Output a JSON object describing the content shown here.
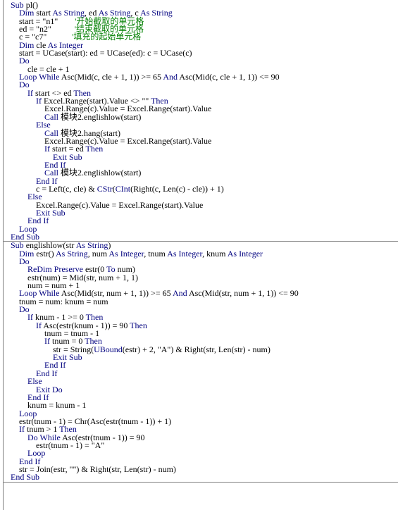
{
  "editor": {
    "title": "VBA Code Module",
    "colors": {
      "background": "#ffffff",
      "keyword": "#00007f",
      "comment": "#007f00",
      "text": "#000000",
      "rule": "#808080"
    }
  },
  "procedures": [
    {
      "name": "pl",
      "lines": [
        [
          {
            "t": "Sub ",
            "c": "kw"
          },
          {
            "t": "pl()",
            "c": "plain"
          }
        ],
        [
          {
            "t": "    ",
            "c": "plain"
          },
          {
            "t": "Dim ",
            "c": "kw"
          },
          {
            "t": "start ",
            "c": "plain"
          },
          {
            "t": "As String",
            "c": "kw"
          },
          {
            "t": ", ed ",
            "c": "plain"
          },
          {
            "t": "As String",
            "c": "kw"
          },
          {
            "t": ", c ",
            "c": "plain"
          },
          {
            "t": "As String",
            "c": "kw"
          }
        ],
        [
          {
            "t": "    start = \"n1\"        ",
            "c": "plain"
          },
          {
            "t": "'开始截取的单元格",
            "c": "cmt"
          }
        ],
        [
          {
            "t": "    ed = \"n2\"           ",
            "c": "plain"
          },
          {
            "t": "'结束截取的单元格",
            "c": "cmt"
          }
        ],
        [
          {
            "t": "    c = \"c7\"            ",
            "c": "plain"
          },
          {
            "t": "'填充的起始单元格",
            "c": "cmt"
          }
        ],
        [
          {
            "t": "    ",
            "c": "plain"
          },
          {
            "t": "Dim ",
            "c": "kw"
          },
          {
            "t": "cle ",
            "c": "plain"
          },
          {
            "t": "As Integer",
            "c": "kw"
          }
        ],
        [
          {
            "t": "    start = UCase(start): ed = UCase(ed): c = UCase(c)",
            "c": "plain"
          }
        ],
        [
          {
            "t": "    ",
            "c": "plain"
          },
          {
            "t": "Do",
            "c": "kw"
          }
        ],
        [
          {
            "t": "        cle = cle + 1",
            "c": "plain"
          }
        ],
        [
          {
            "t": "    ",
            "c": "plain"
          },
          {
            "t": "Loop While ",
            "c": "kw"
          },
          {
            "t": "Asc(Mid(c, cle + 1, 1)) >= 65 ",
            "c": "plain"
          },
          {
            "t": "And ",
            "c": "kw"
          },
          {
            "t": "Asc(Mid(c, cle + 1, 1)) <= 90",
            "c": "plain"
          }
        ],
        [
          {
            "t": "    ",
            "c": "plain"
          },
          {
            "t": "Do",
            "c": "kw"
          }
        ],
        [
          {
            "t": "        ",
            "c": "plain"
          },
          {
            "t": "If ",
            "c": "kw"
          },
          {
            "t": "start <> ed ",
            "c": "plain"
          },
          {
            "t": "Then",
            "c": "kw"
          }
        ],
        [
          {
            "t": "            ",
            "c": "plain"
          },
          {
            "t": "If ",
            "c": "kw"
          },
          {
            "t": "Excel.Range(start).Value <> \"\" ",
            "c": "plain"
          },
          {
            "t": "Then",
            "c": "kw"
          }
        ],
        [
          {
            "t": "                Excel.Range(c).Value = Excel.Range(start).Value",
            "c": "plain"
          }
        ],
        [
          {
            "t": "                ",
            "c": "plain"
          },
          {
            "t": "Call ",
            "c": "kw"
          },
          {
            "t": "模块2.englishlow(start)",
            "c": "plain"
          }
        ],
        [
          {
            "t": "            ",
            "c": "plain"
          },
          {
            "t": "Else",
            "c": "kw"
          }
        ],
        [
          {
            "t": "                ",
            "c": "plain"
          },
          {
            "t": "Call ",
            "c": "kw"
          },
          {
            "t": "模块2.hang(start)",
            "c": "plain"
          }
        ],
        [
          {
            "t": "                Excel.Range(c).Value = Excel.Range(start).Value",
            "c": "plain"
          }
        ],
        [
          {
            "t": "                ",
            "c": "plain"
          },
          {
            "t": "If ",
            "c": "kw"
          },
          {
            "t": "start = ed ",
            "c": "plain"
          },
          {
            "t": "Then",
            "c": "kw"
          }
        ],
        [
          {
            "t": "                    ",
            "c": "plain"
          },
          {
            "t": "Exit Sub",
            "c": "kw"
          }
        ],
        [
          {
            "t": "                ",
            "c": "plain"
          },
          {
            "t": "End If",
            "c": "kw"
          }
        ],
        [
          {
            "t": "                ",
            "c": "plain"
          },
          {
            "t": "Call ",
            "c": "kw"
          },
          {
            "t": "模块2.englishlow(start)",
            "c": "plain"
          }
        ],
        [
          {
            "t": "            ",
            "c": "plain"
          },
          {
            "t": "End If",
            "c": "kw"
          }
        ],
        [
          {
            "t": "            c = Left(c, cle) & ",
            "c": "plain"
          },
          {
            "t": "CStr",
            "c": "kw"
          },
          {
            "t": "(",
            "c": "plain"
          },
          {
            "t": "CInt",
            "c": "kw"
          },
          {
            "t": "(Right(c, Len(c) - cle)) + 1)",
            "c": "plain"
          }
        ],
        [
          {
            "t": "        ",
            "c": "plain"
          },
          {
            "t": "Else",
            "c": "kw"
          }
        ],
        [
          {
            "t": "            Excel.Range(c).Value = Excel.Range(start).Value",
            "c": "plain"
          }
        ],
        [
          {
            "t": "            ",
            "c": "plain"
          },
          {
            "t": "Exit Sub",
            "c": "kw"
          }
        ],
        [
          {
            "t": "        ",
            "c": "plain"
          },
          {
            "t": "End If",
            "c": "kw"
          }
        ],
        [
          {
            "t": "    ",
            "c": "plain"
          },
          {
            "t": "Loop",
            "c": "kw"
          }
        ],
        [
          {
            "t": "End Sub",
            "c": "kw"
          }
        ]
      ]
    },
    {
      "name": "englishlow",
      "lines": [
        [
          {
            "t": "Sub ",
            "c": "kw"
          },
          {
            "t": "englishlow(str ",
            "c": "plain"
          },
          {
            "t": "As String",
            "c": "kw"
          },
          {
            "t": ")",
            "c": "plain"
          }
        ],
        [
          {
            "t": "    ",
            "c": "plain"
          },
          {
            "t": "Dim ",
            "c": "kw"
          },
          {
            "t": "estr() ",
            "c": "plain"
          },
          {
            "t": "As String",
            "c": "kw"
          },
          {
            "t": ", num ",
            "c": "plain"
          },
          {
            "t": "As Integer",
            "c": "kw"
          },
          {
            "t": ", tnum ",
            "c": "plain"
          },
          {
            "t": "As Integer",
            "c": "kw"
          },
          {
            "t": ", knum ",
            "c": "plain"
          },
          {
            "t": "As Integer",
            "c": "kw"
          }
        ],
        [
          {
            "t": "    ",
            "c": "plain"
          },
          {
            "t": "Do",
            "c": "kw"
          }
        ],
        [
          {
            "t": "        ",
            "c": "plain"
          },
          {
            "t": "ReDim Preserve ",
            "c": "kw"
          },
          {
            "t": "estr(0 ",
            "c": "plain"
          },
          {
            "t": "To",
            "c": "kw"
          },
          {
            "t": " num)",
            "c": "plain"
          }
        ],
        [
          {
            "t": "        estr(num) = Mid(str, num + 1, 1)",
            "c": "plain"
          }
        ],
        [
          {
            "t": "        num = num + 1",
            "c": "plain"
          }
        ],
        [
          {
            "t": "    ",
            "c": "plain"
          },
          {
            "t": "Loop While ",
            "c": "kw"
          },
          {
            "t": "Asc(Mid(str, num + 1, 1)) >= 65 ",
            "c": "plain"
          },
          {
            "t": "And ",
            "c": "kw"
          },
          {
            "t": "Asc(Mid(str, num + 1, 1)) <= 90",
            "c": "plain"
          }
        ],
        [
          {
            "t": "    tnum = num: knum = num",
            "c": "plain"
          }
        ],
        [
          {
            "t": "    ",
            "c": "plain"
          },
          {
            "t": "Do",
            "c": "kw"
          }
        ],
        [
          {
            "t": "        ",
            "c": "plain"
          },
          {
            "t": "If ",
            "c": "kw"
          },
          {
            "t": "knum - 1 >= 0 ",
            "c": "plain"
          },
          {
            "t": "Then",
            "c": "kw"
          }
        ],
        [
          {
            "t": "            ",
            "c": "plain"
          },
          {
            "t": "If ",
            "c": "kw"
          },
          {
            "t": "Asc(estr(knum - 1)) = 90 ",
            "c": "plain"
          },
          {
            "t": "Then",
            "c": "kw"
          }
        ],
        [
          {
            "t": "                tnum = tnum - 1",
            "c": "plain"
          }
        ],
        [
          {
            "t": "                ",
            "c": "plain"
          },
          {
            "t": "If ",
            "c": "kw"
          },
          {
            "t": "tnum = 0 ",
            "c": "plain"
          },
          {
            "t": "Then",
            "c": "kw"
          }
        ],
        [
          {
            "t": "                    str = String(",
            "c": "plain"
          },
          {
            "t": "UBound",
            "c": "kw"
          },
          {
            "t": "(estr) + 2, \"A\") & Right(str, Len(str) - num)",
            "c": "plain"
          }
        ],
        [
          {
            "t": "                    ",
            "c": "plain"
          },
          {
            "t": "Exit Sub",
            "c": "kw"
          }
        ],
        [
          {
            "t": "                ",
            "c": "plain"
          },
          {
            "t": "End If",
            "c": "kw"
          }
        ],
        [
          {
            "t": "            ",
            "c": "plain"
          },
          {
            "t": "End If",
            "c": "kw"
          }
        ],
        [
          {
            "t": "        ",
            "c": "plain"
          },
          {
            "t": "Else",
            "c": "kw"
          }
        ],
        [
          {
            "t": "            ",
            "c": "plain"
          },
          {
            "t": "Exit Do",
            "c": "kw"
          }
        ],
        [
          {
            "t": "        ",
            "c": "plain"
          },
          {
            "t": "End If",
            "c": "kw"
          }
        ],
        [
          {
            "t": "        knum = knum - 1",
            "c": "plain"
          }
        ],
        [
          {
            "t": "    ",
            "c": "plain"
          },
          {
            "t": "Loop",
            "c": "kw"
          }
        ],
        [
          {
            "t": "    estr(tnum - 1) = Chr(Asc(estr(tnum - 1)) + 1)",
            "c": "plain"
          }
        ],
        [
          {
            "t": "    ",
            "c": "plain"
          },
          {
            "t": "If ",
            "c": "kw"
          },
          {
            "t": "tnum > 1 ",
            "c": "plain"
          },
          {
            "t": "Then",
            "c": "kw"
          }
        ],
        [
          {
            "t": "        ",
            "c": "plain"
          },
          {
            "t": "Do While ",
            "c": "kw"
          },
          {
            "t": "Asc(estr(tnum - 1)) = 90",
            "c": "plain"
          }
        ],
        [
          {
            "t": "            estr(tnum - 1) = \"A\"",
            "c": "plain"
          }
        ],
        [
          {
            "t": "        ",
            "c": "plain"
          },
          {
            "t": "Loop",
            "c": "kw"
          }
        ],
        [
          {
            "t": "    ",
            "c": "plain"
          },
          {
            "t": "End If",
            "c": "kw"
          }
        ],
        [
          {
            "t": "    str = Join(estr, \"\") & Right(str, Len(str) - num)",
            "c": "plain"
          }
        ],
        [
          {
            "t": "End Sub",
            "c": "kw"
          }
        ]
      ]
    }
  ]
}
